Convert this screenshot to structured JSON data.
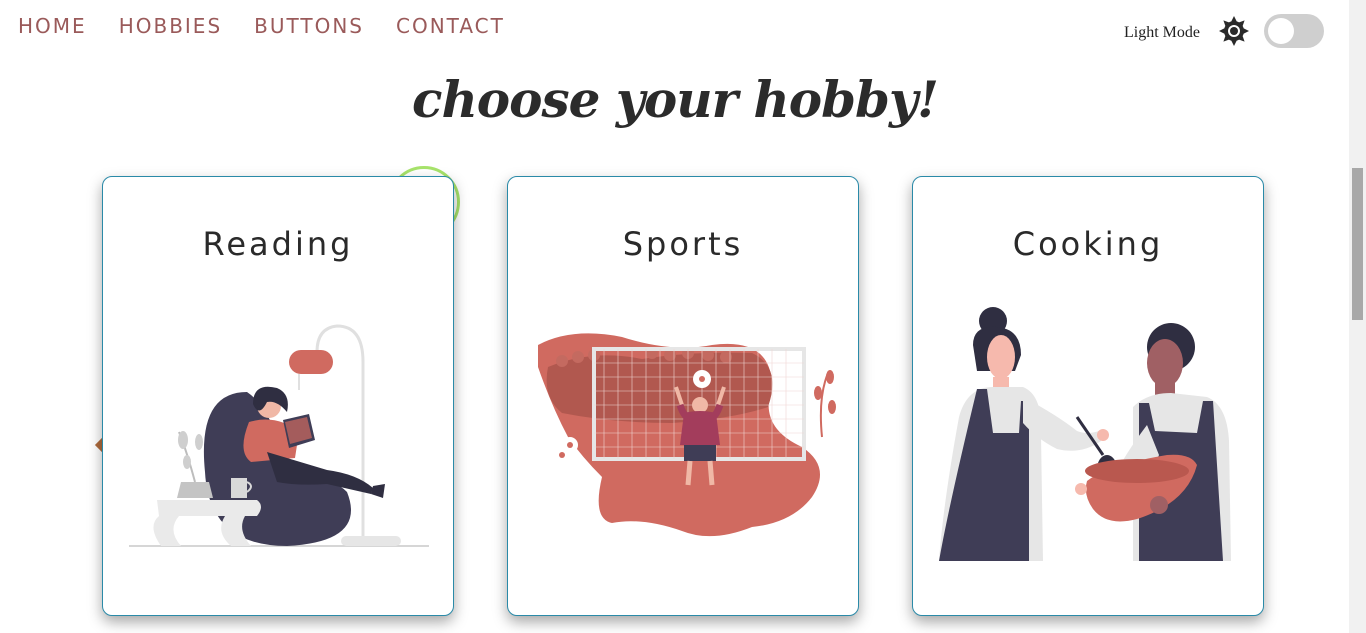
{
  "nav": {
    "items": [
      {
        "label": "HOME"
      },
      {
        "label": "HOBBIES"
      },
      {
        "label": "BUTTONS"
      },
      {
        "label": "CONTACT"
      }
    ]
  },
  "theme": {
    "label": "Light Mode",
    "icon": "sun-icon",
    "enabled": false
  },
  "page": {
    "title": "choose your hobby!"
  },
  "cards": [
    {
      "title": "Reading",
      "illustration": "reading-illustration"
    },
    {
      "title": "Sports",
      "illustration": "soccer-goalkeeper-illustration"
    },
    {
      "title": "Cooking",
      "illustration": "cooking-illustration"
    }
  ],
  "colors": {
    "nav": "#9a5a5a",
    "accent": "#d06a60",
    "dark": "#3f3d56",
    "card_border": "#2a8aa8"
  }
}
